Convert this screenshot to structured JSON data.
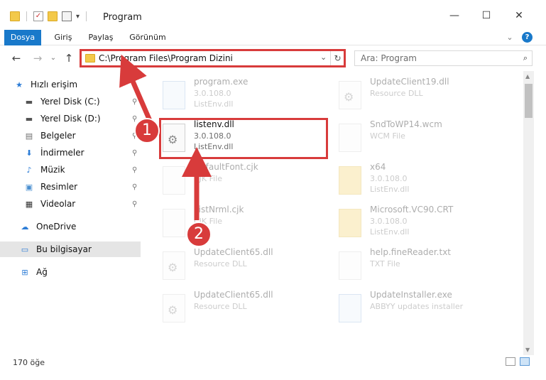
{
  "window": {
    "title": "Program",
    "minimize": "—",
    "maximize": "☐",
    "close": "✕"
  },
  "ribbon": {
    "tabs": [
      "Dosya",
      "Giriş",
      "Paylaş",
      "Görünüm"
    ],
    "expand": "⌄",
    "help": "?"
  },
  "nav": {
    "back": "←",
    "forward": "→",
    "recent": "⌄",
    "up": "↑",
    "address": "C:\\Program Files\\Program Dizini",
    "address_dropdown": "⌄",
    "refresh": "↻",
    "search_placeholder": "Ara: Program",
    "search_icon": "🔍"
  },
  "sidebar": {
    "items": [
      {
        "label": "Hızlı erişim",
        "icon": "star-icon",
        "glyph": "★",
        "color": "#2c7cd6"
      },
      {
        "label": "Yerel Disk (C:)",
        "icon": "drive-icon",
        "glyph": "▬",
        "color": "#555555",
        "pinned": true
      },
      {
        "label": "Yerel Disk (D:)",
        "icon": "drive-icon",
        "glyph": "▬",
        "color": "#555555",
        "pinned": true
      },
      {
        "label": "Belgeler",
        "icon": "document-icon",
        "glyph": "▤",
        "color": "#6f6f6f",
        "pinned": true
      },
      {
        "label": "İndirmeler",
        "icon": "download-icon",
        "glyph": "⬇",
        "color": "#2c7cd6",
        "pinned": true
      },
      {
        "label": "Müzik",
        "icon": "music-icon",
        "glyph": "♪",
        "color": "#2c7cd6",
        "pinned": true
      },
      {
        "label": "Resimler",
        "icon": "pictures-icon",
        "glyph": "▣",
        "color": "#4a8fd0",
        "pinned": true
      },
      {
        "label": "Videolar",
        "icon": "video-icon",
        "glyph": "▦",
        "color": "#333333",
        "pinned": true
      },
      {
        "label": "OneDrive",
        "icon": "cloud-icon",
        "glyph": "☁",
        "color": "#2c7cd6"
      },
      {
        "label": "Bu bilgisayar",
        "icon": "computer-icon",
        "glyph": "▭",
        "color": "#2c7cd6",
        "selected": true
      },
      {
        "label": "Ağ",
        "icon": "network-icon",
        "glyph": "⊞",
        "color": "#2c7cd6"
      }
    ],
    "pin_glyph": "📌"
  },
  "files": [
    {
      "name": "program.exe",
      "line2": "3.0.108.0",
      "line3": "ListEnv.dll",
      "kind": "app"
    },
    {
      "name": "UpdateClient19.dll",
      "line2": "Resource DLL",
      "line3": "",
      "kind": "gear"
    },
    {
      "name": "listenv.dll",
      "line2": "3.0.108.0",
      "line3": "ListEnv.dll",
      "kind": "gear",
      "selected": true
    },
    {
      "name": "SndToWP14.wcm",
      "line2": "WCM File",
      "line3": "",
      "kind": "blank"
    },
    {
      "name": "DefaultFont.cjk",
      "line2": "CJK File",
      "line3": "",
      "kind": "blank"
    },
    {
      "name": "x64",
      "line2": "3.0.108.0",
      "line3": "ListEnv.dll",
      "kind": "yfold"
    },
    {
      "name": "ListNrml.cjk",
      "line2": "CJK File",
      "line3": "",
      "kind": "blank"
    },
    {
      "name": "Microsoft.VC90.CRT",
      "line2": "3.0.108.0",
      "line3": "ListEnv.dll",
      "kind": "yfold"
    },
    {
      "name": "UpdateClient65.dll",
      "line2": "Resource DLL",
      "line3": "",
      "kind": "gear"
    },
    {
      "name": "help.fineReader.txt",
      "line2": "TXT File",
      "line3": "",
      "kind": "blank"
    },
    {
      "name": "UpdateClient65.dll",
      "line2": "Resource DLL",
      "line3": "",
      "kind": "gear"
    },
    {
      "name": "UpdateInstaller.exe",
      "line2": "ABBYY updates installer",
      "line3": "",
      "kind": "app"
    }
  ],
  "status": {
    "count": "170 öğe"
  },
  "annotations": {
    "step1": "1",
    "step2": "2",
    "highlight_color": "#d83b3b"
  }
}
